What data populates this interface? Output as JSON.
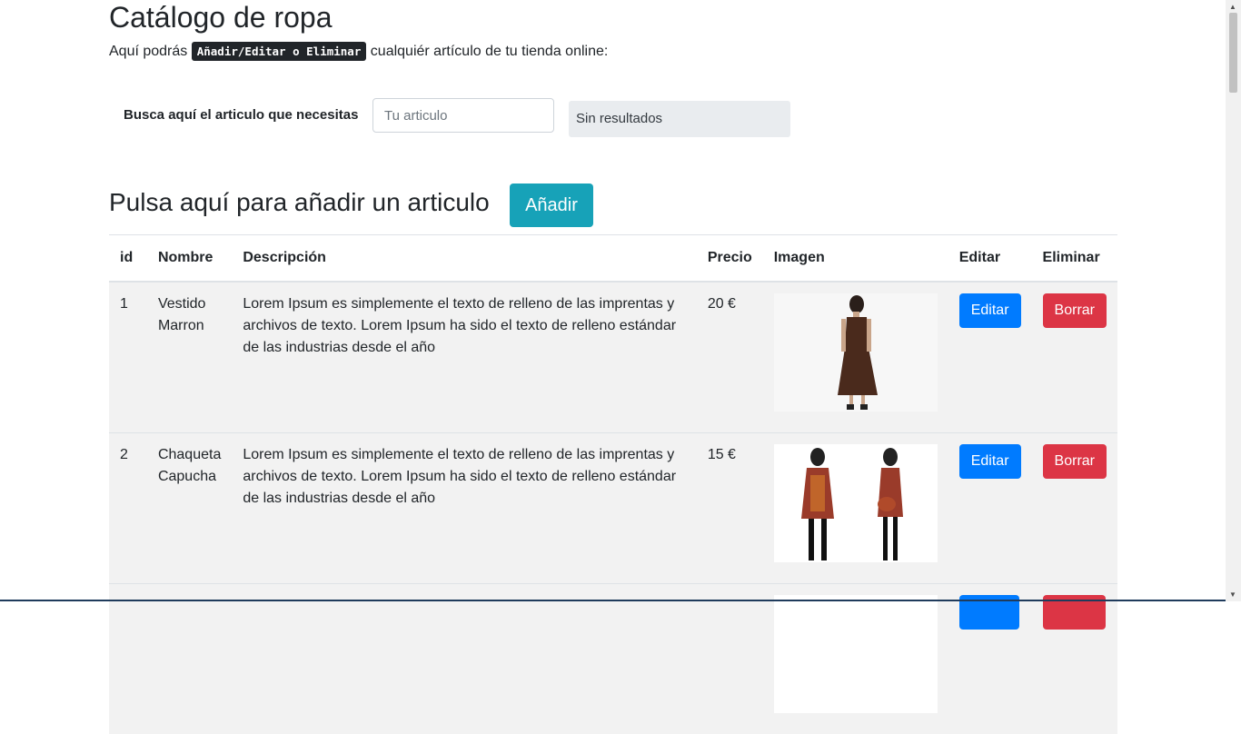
{
  "header": {
    "title": "Catálogo de ropa",
    "intro_before": "Aquí podrás ",
    "intro_code": "Añadir/Editar o Eliminar",
    "intro_after": " cualquiér artículo de tu tienda online:"
  },
  "search": {
    "label": "Busca aquí el articulo que necesitas",
    "placeholder": "Tu articulo",
    "value": "",
    "result": "Sin resultados"
  },
  "add_section": {
    "heading": "Pulsa aquí para añadir un articulo",
    "button_label": "Añadir"
  },
  "table": {
    "headers": {
      "id": "id",
      "name": "Nombre",
      "description": "Descripción",
      "price": "Precio",
      "image": "Imagen",
      "edit": "Editar",
      "delete": "Eliminar"
    },
    "rows": [
      {
        "id": "1",
        "name": "Vestido Marron",
        "description": "Lorem Ipsum es simplemente el texto de relleno de las imprentas y archivos de texto. Lorem Ipsum ha sido el texto de relleno estándar de las industrias desde el año",
        "price": "20 €",
        "edit_label": "Editar",
        "delete_label": "Borrar"
      },
      {
        "id": "2",
        "name": "Chaqueta Capucha",
        "description": "Lorem Ipsum es simplemente el texto de relleno de las imprentas y archivos de texto. Lorem Ipsum ha sido el texto de relleno estándar de las industrias desde el año",
        "price": "15 €",
        "edit_label": "Editar",
        "delete_label": "Borrar"
      },
      {
        "id": "",
        "name": "",
        "description": "",
        "price": "",
        "edit_label": "",
        "delete_label": ""
      }
    ]
  },
  "colors": {
    "add_button": "#17a2b8",
    "edit_button": "#007bff",
    "delete_button": "#dc3545",
    "row_background": "#f2f2f2"
  }
}
